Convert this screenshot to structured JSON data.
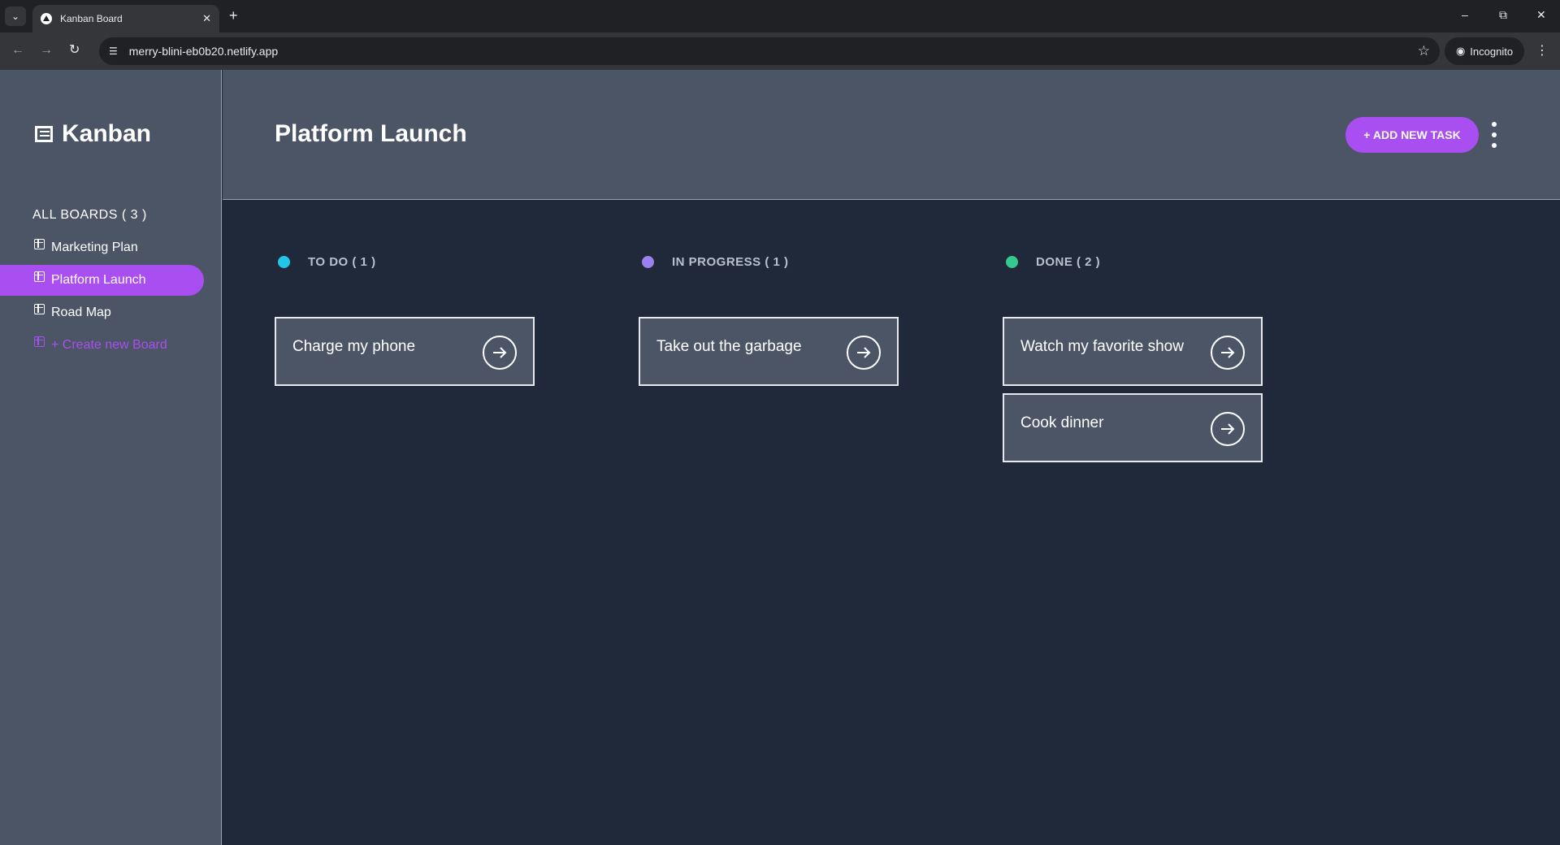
{
  "browser": {
    "tab_title": "Kanban Board",
    "url": "merry-blini-eb0b20.netlify.app",
    "incognito_label": "Incognito"
  },
  "sidebar": {
    "logo_text": "Kanban",
    "boards_heading": "ALL BOARDS ( 3 )",
    "boards": [
      {
        "label": "Marketing Plan",
        "active": false
      },
      {
        "label": "Platform Launch",
        "active": true
      },
      {
        "label": "Road Map",
        "active": false
      }
    ],
    "create_label": "+ Create new Board"
  },
  "header": {
    "board_title": "Platform Launch",
    "add_task_label": "+ ADD NEW TASK"
  },
  "columns": [
    {
      "title": "TO DO  ( 1 )",
      "color": "#22c6e8",
      "cards": [
        {
          "title": "Charge my phone"
        }
      ]
    },
    {
      "title": "IN PROGRESS  ( 1 )",
      "color": "#9b80f0",
      "cards": [
        {
          "title": "Take out the garbage"
        }
      ]
    },
    {
      "title": "DONE  ( 2 )",
      "color": "#35c98e",
      "cards": [
        {
          "title": "Watch my favorite show"
        },
        {
          "title": "Cook dinner"
        }
      ]
    }
  ],
  "colors": {
    "accent": "#a94ff1",
    "panel": "#4c5566",
    "board_bg": "#20293a"
  }
}
